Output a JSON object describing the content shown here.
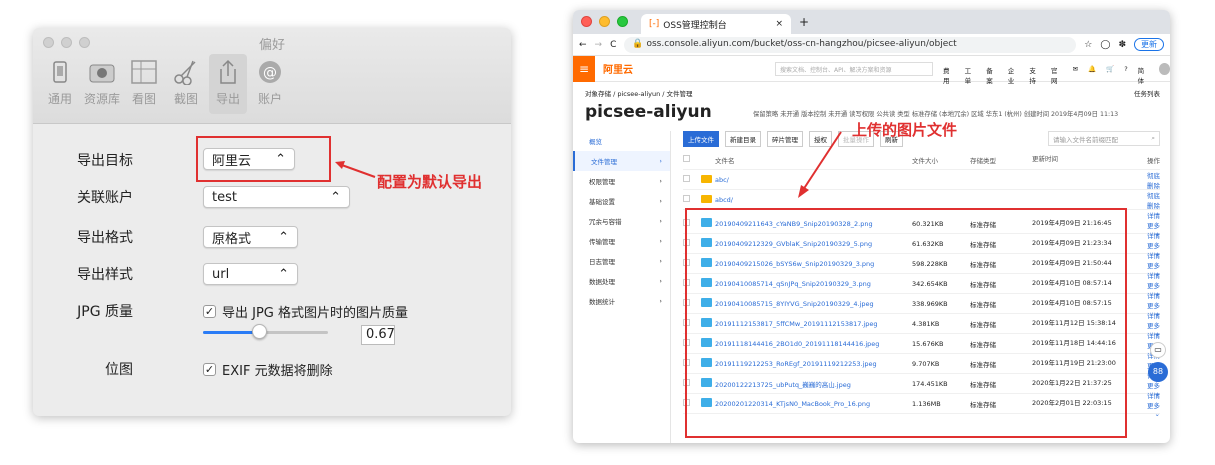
{
  "prefs": {
    "title": "偏好",
    "toolbar": [
      "通用",
      "资源库",
      "看图",
      "截图",
      "导出",
      "账户"
    ],
    "fields": [
      {
        "label": "导出目标",
        "value": "阿里云"
      },
      {
        "label": "关联账户",
        "value": "test"
      },
      {
        "label": "导出格式",
        "value": "原格式"
      },
      {
        "label": "导出样式",
        "value": "url"
      }
    ],
    "jpg_label": "JPG 质量",
    "jpg_check": "导出 JPG 格式图片时的图片质量",
    "jpg_value": "0.67",
    "slider_fraction": 0.45,
    "pos_label": "位图",
    "exif_check": "EXIF 元数据将删除",
    "annotation": "配置为默认导出"
  },
  "browser": {
    "tab_title": "OSS管理控制台",
    "url": "oss.console.aliyun.com/bucket/oss-cn-hangzhou/picsee-aliyun/object",
    "logo": "阿里云",
    "search": "搜索文档、控制台、API、解决方案和资源",
    "topnav": [
      "费用",
      "工单",
      "备案",
      "企业",
      "支持",
      "官网",
      "简体"
    ],
    "update": "更新",
    "breadcrumb": "对象存储 / picsee-aliyun / 文件管理",
    "task": "任务列表",
    "bucket": "picsee-aliyun",
    "meta": "保留策略 未开通   版本控制 未开通   读写权限 公共读   类型 标准存储 (本地冗余)   区域 华东1 (杭州)   创建时间 2019年4月09日 11:13",
    "sidebar": [
      "概览",
      "文件管理",
      "权限管理",
      "基础设置",
      "冗余与容错",
      "传输管理",
      "日志管理",
      "数据处理",
      "数据统计"
    ],
    "buttons": [
      "上传文件",
      "新建目录",
      "碎片管理",
      "授权",
      "批量操作",
      "刷新"
    ],
    "search_ph": "请输入文件名前缀匹配",
    "annotation": "上传的图片文件",
    "cols": [
      "文件名",
      "文件大小",
      "存储类型",
      "更新时间",
      "操作"
    ],
    "folders": [
      {
        "name": "abc/",
        "op": "彻底删除"
      },
      {
        "name": "abcd/",
        "op": "彻底删除"
      }
    ],
    "files": [
      {
        "name": "20190409211643_cYaNB9_Snip20190328_2.png",
        "size": "60.321KB",
        "type": "标准存储",
        "time": "2019年4月09日 21:16:45"
      },
      {
        "name": "20190409212329_GVblaK_Snip20190329_5.png",
        "size": "61.632KB",
        "type": "标准存储",
        "time": "2019年4月09日 21:23:34"
      },
      {
        "name": "20190409215026_bSYS6w_Snip20190329_3.png",
        "size": "598.228KB",
        "type": "标准存储",
        "time": "2019年4月09日 21:50:44"
      },
      {
        "name": "20190410085714_qSnJPq_Snip20190329_3.png",
        "size": "342.654KB",
        "type": "标准存储",
        "time": "2019年4月10日 08:57:14"
      },
      {
        "name": "20190410085715_8YIYVG_Snip20190329_4.jpeg",
        "size": "338.969KB",
        "type": "标准存储",
        "time": "2019年4月10日 08:57:15"
      },
      {
        "name": "20191112153817_5ffCMw_20191112153817.jpeg",
        "size": "4.381KB",
        "type": "标准存储",
        "time": "2019年11月12日 15:38:14"
      },
      {
        "name": "20191118144416_2BO1d0_20191118144416.jpeg",
        "size": "15.676KB",
        "type": "标准存储",
        "time": "2019年11月18日 14:44:16"
      },
      {
        "name": "20191119212253_RoREgf_20191119212253.jpeg",
        "size": "9.707KB",
        "type": "标准存储",
        "time": "2019年11月19日 21:23:00"
      },
      {
        "name": "20200122213725_ubPutq_巍巍的高山.jpeg",
        "size": "174.451KB",
        "type": "标准存储",
        "time": "2020年1月22日 21:37:25"
      },
      {
        "name": "20200201220314_KTjsN0_MacBook_Pro_16.png",
        "size": "1.136MB",
        "type": "标准存储",
        "time": "2020年2月01日 22:03:15"
      }
    ],
    "ops": "详情 更多"
  }
}
